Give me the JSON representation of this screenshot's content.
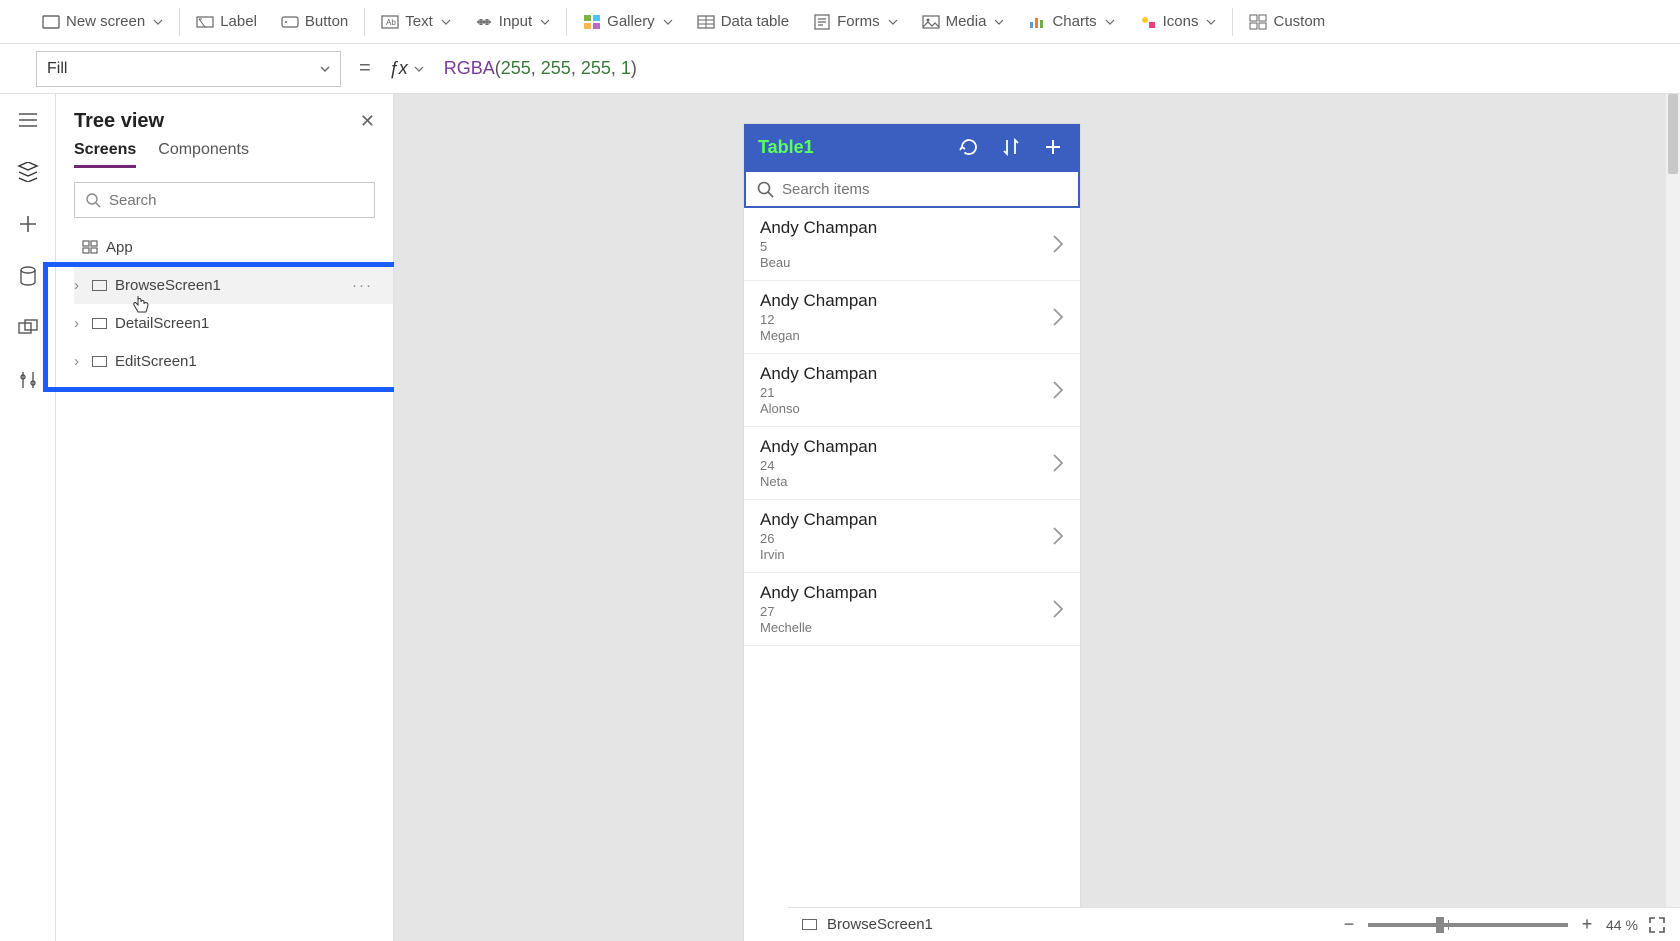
{
  "ribbon": {
    "newscreen": "New screen",
    "label": "Label",
    "button": "Button",
    "text": "Text",
    "input": "Input",
    "gallery": "Gallery",
    "datatable": "Data table",
    "forms": "Forms",
    "media": "Media",
    "charts": "Charts",
    "icons": "Icons",
    "custom": "Custom"
  },
  "propertybar": {
    "property": "Fill",
    "formula_func": "RGBA",
    "formula_args": [
      "255",
      "255",
      "255",
      "1"
    ]
  },
  "treepanel": {
    "title": "Tree view",
    "tabs": {
      "screens": "Screens",
      "components": "Components"
    },
    "search_placeholder": "Search",
    "app_node": "App",
    "screens": [
      "BrowseScreen1",
      "DetailScreen1",
      "EditScreen1"
    ]
  },
  "appcanvas": {
    "title": "Table1",
    "search_placeholder": "Search items",
    "items": [
      {
        "name": "Andy Champan",
        "num": "5",
        "sub": "Beau"
      },
      {
        "name": "Andy Champan",
        "num": "12",
        "sub": "Megan"
      },
      {
        "name": "Andy Champan",
        "num": "21",
        "sub": "Alonso"
      },
      {
        "name": "Andy Champan",
        "num": "24",
        "sub": "Neta"
      },
      {
        "name": "Andy Champan",
        "num": "26",
        "sub": "Irvin"
      },
      {
        "name": "Andy Champan",
        "num": "27",
        "sub": "Mechelle"
      }
    ]
  },
  "statusbar": {
    "selected": "BrowseScreen1",
    "zoom_value": "44",
    "zoom_unit": "%"
  }
}
